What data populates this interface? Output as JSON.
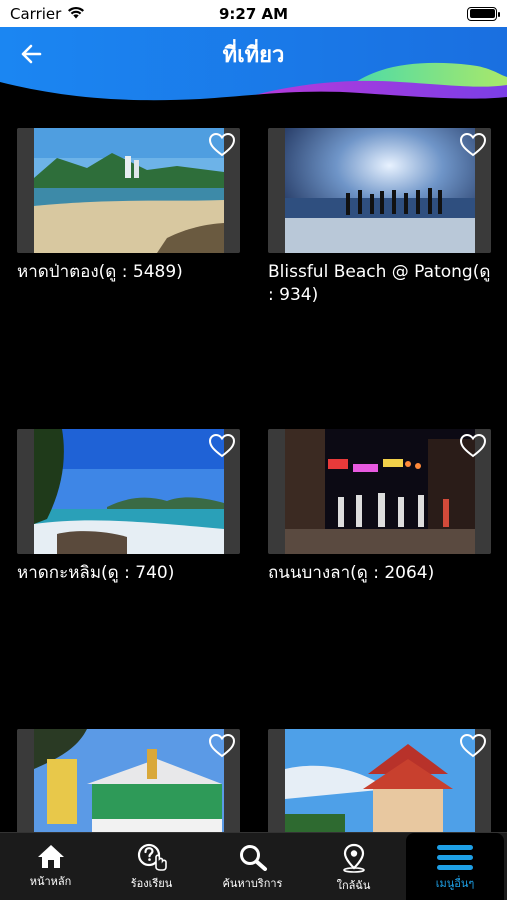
{
  "status_bar": {
    "carrier": "Carrier",
    "time": "9:27 AM"
  },
  "header": {
    "title": "ที่เที่ยว",
    "back_icon": "arrow-left-icon"
  },
  "places": [
    {
      "label": "หาดป่าตอง(ดู : 5489)",
      "image": "beach-patong-photo"
    },
    {
      "label": "Blissful Beach @ Patong(ดู : 934)",
      "image": "beach-silhouettes-photo"
    },
    {
      "label": "หาดกะหลิม(ดู : 740)",
      "image": "beach-kalim-photo"
    },
    {
      "label": "ถนนบางลา(ดู : 2064)",
      "image": "bangla-street-night-photo"
    },
    {
      "label": "",
      "image": "shrine-photo"
    },
    {
      "label": "",
      "image": "temple-photo"
    }
  ],
  "bottom_nav": {
    "items": [
      {
        "label": "หน้าหลัก",
        "icon": "home-icon"
      },
      {
        "label": "ร้องเรียน",
        "icon": "help-tap-icon"
      },
      {
        "label": "ค้นหาบริการ",
        "icon": "search-icon"
      },
      {
        "label": "ใกล้ฉัน",
        "icon": "location-pin-icon"
      },
      {
        "label": "เมนูอื่นๆ",
        "icon": "hamburger-menu-icon"
      }
    ],
    "active_index": 4
  },
  "colors": {
    "header_blue": "#1a8cf0",
    "accent": "#1ea0e6",
    "background": "#000000"
  }
}
